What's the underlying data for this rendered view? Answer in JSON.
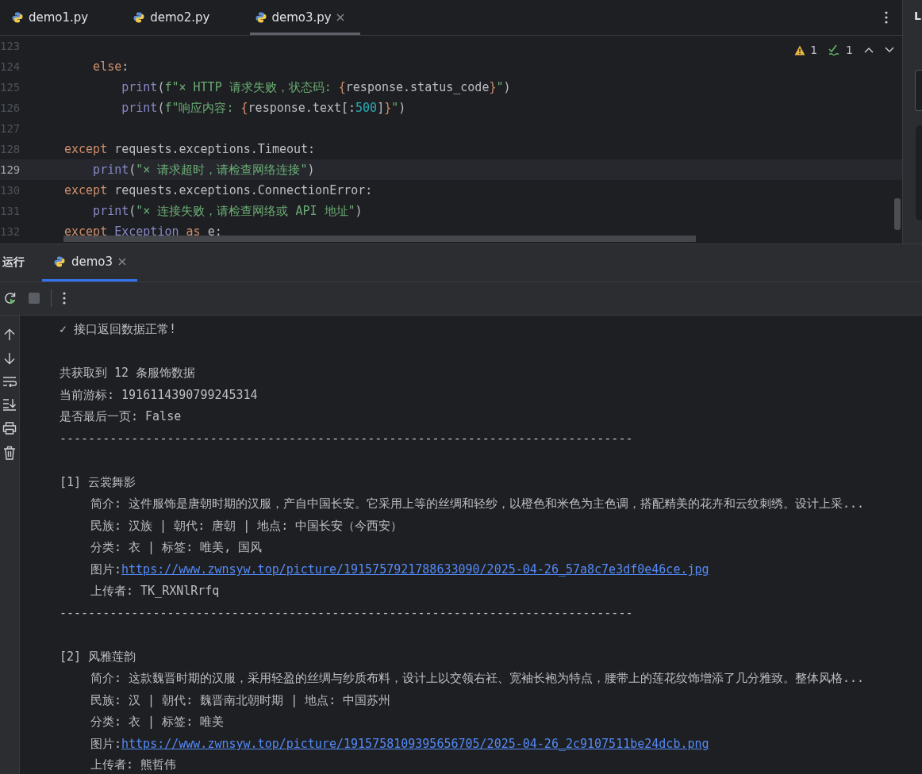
{
  "tabs": [
    {
      "label": "demo1.py",
      "selected": false
    },
    {
      "label": "demo2.py",
      "selected": false
    },
    {
      "label": "demo3.py",
      "selected": true
    }
  ],
  "side_panel": {
    "label": "L"
  },
  "editor": {
    "warnings": "1",
    "checks": "1",
    "lines": [
      {
        "number": "123",
        "current": false
      },
      {
        "number": "124",
        "current": false,
        "tokens": [
          {
            "kind": "keyword",
            "text": "    else"
          },
          {
            "kind": "plain",
            "text": ":"
          }
        ]
      },
      {
        "number": "125",
        "current": false,
        "tokens": [
          {
            "kind": "builtin",
            "text": "        print"
          },
          {
            "kind": "plain",
            "text": "("
          },
          {
            "kind": "string",
            "text": "f\"× HTTP 请求失败，状态码: "
          },
          {
            "kind": "keyword",
            "text": "{"
          },
          {
            "kind": "plain",
            "text": "response.status_code"
          },
          {
            "kind": "keyword",
            "text": "}"
          },
          {
            "kind": "string",
            "text": "\""
          },
          {
            "kind": "plain",
            "text": ")"
          }
        ]
      },
      {
        "number": "126",
        "current": false,
        "tokens": [
          {
            "kind": "builtin",
            "text": "        print"
          },
          {
            "kind": "plain",
            "text": "("
          },
          {
            "kind": "string",
            "text": "f\"响应内容: "
          },
          {
            "kind": "keyword",
            "text": "{"
          },
          {
            "kind": "plain",
            "text": "response.text[:"
          },
          {
            "kind": "number",
            "text": "500"
          },
          {
            "kind": "plain",
            "text": "]"
          },
          {
            "kind": "keyword",
            "text": "}"
          },
          {
            "kind": "string",
            "text": "\""
          },
          {
            "kind": "plain",
            "text": ")"
          }
        ]
      },
      {
        "number": "127",
        "current": false
      },
      {
        "number": "128",
        "current": false,
        "tokens": [
          {
            "kind": "keyword",
            "text": "except "
          },
          {
            "kind": "plain",
            "text": "requests.exceptions.Timeout:"
          }
        ]
      },
      {
        "number": "129",
        "current": true,
        "tokens": [
          {
            "kind": "builtin",
            "text": "    print"
          },
          {
            "kind": "plain",
            "text": "("
          },
          {
            "kind": "string",
            "text": "\"× 请求超时，请检查网络连接\""
          },
          {
            "kind": "plain",
            "text": ")"
          }
        ]
      },
      {
        "number": "130",
        "current": false,
        "tokens": [
          {
            "kind": "keyword",
            "text": "except "
          },
          {
            "kind": "plain",
            "text": "requests.exceptions.ConnectionError:"
          }
        ]
      },
      {
        "number": "131",
        "current": false,
        "tokens": [
          {
            "kind": "builtin",
            "text": "    print"
          },
          {
            "kind": "plain",
            "text": "("
          },
          {
            "kind": "string",
            "text": "\"× 连接失败，请检查网络或 API 地址\""
          },
          {
            "kind": "plain",
            "text": ")"
          }
        ]
      },
      {
        "number": "132",
        "current": false,
        "tokens": [
          {
            "kind": "keyword",
            "text": "except "
          },
          {
            "kind": "builtin",
            "text": "Exception "
          },
          {
            "kind": "keyword",
            "text": "as "
          },
          {
            "kind": "plain",
            "text": "e:"
          }
        ]
      }
    ]
  },
  "run_panel": {
    "title": "运行",
    "tabs": [
      {
        "label": "demo3",
        "selected": true
      }
    ]
  },
  "console": [
    {
      "kind": "text",
      "indent": false,
      "parts": [
        {
          "kind": "text",
          "text": "✓ 接口返回数据正常!"
        }
      ]
    },
    {
      "kind": "blank"
    },
    {
      "kind": "text",
      "indent": false,
      "parts": [
        {
          "kind": "text",
          "text": "共获取到 12 条服饰数据"
        }
      ]
    },
    {
      "kind": "text",
      "indent": false,
      "parts": [
        {
          "kind": "text",
          "text": "当前游标: 1916114390799245314"
        }
      ]
    },
    {
      "kind": "text",
      "indent": false,
      "parts": [
        {
          "kind": "text",
          "text": "是否最后一页: False"
        }
      ]
    },
    {
      "kind": "text",
      "indent": false,
      "parts": [
        {
          "kind": "text",
          "text": "--------------------------------------------------------------------------------"
        }
      ]
    },
    {
      "kind": "blank"
    },
    {
      "kind": "text",
      "indent": false,
      "parts": [
        {
          "kind": "text",
          "text": "[1] 云裳舞影"
        }
      ]
    },
    {
      "kind": "text",
      "indent": true,
      "parts": [
        {
          "kind": "text",
          "text": "简介: 这件服饰是唐朝时期的汉服，产自中国长安。它采用上等的丝绸和轻纱，以橙色和米色为主色调，搭配精美的花卉和云纹刺绣。设计上采..."
        }
      ]
    },
    {
      "kind": "text",
      "indent": true,
      "parts": [
        {
          "kind": "text",
          "text": "民族: 汉族 | 朝代: 唐朝 | 地点: 中国长安（今西安）"
        }
      ]
    },
    {
      "kind": "text",
      "indent": true,
      "parts": [
        {
          "kind": "text",
          "text": "分类: 衣 | 标签: 唯美, 国风"
        }
      ]
    },
    {
      "kind": "text",
      "indent": true,
      "parts": [
        {
          "kind": "text",
          "text": "图片: "
        },
        {
          "kind": "link",
          "text": "https://www.zwnsyw.top/picture/1915757921788633090/2025-04-26_57a8c7e3df0e46ce.jpg"
        }
      ]
    },
    {
      "kind": "text",
      "indent": true,
      "parts": [
        {
          "kind": "text",
          "text": "上传者: TK_RXNlRrfq"
        }
      ]
    },
    {
      "kind": "text",
      "indent": false,
      "parts": [
        {
          "kind": "text",
          "text": "--------------------------------------------------------------------------------"
        }
      ]
    },
    {
      "kind": "blank"
    },
    {
      "kind": "text",
      "indent": false,
      "parts": [
        {
          "kind": "text",
          "text": "[2] 风雅莲韵"
        }
      ]
    },
    {
      "kind": "text",
      "indent": true,
      "parts": [
        {
          "kind": "text",
          "text": "简介: 这款魏晋时期的汉服，采用轻盈的丝绸与纱质布料，设计上以交领右衽、宽袖长袍为特点，腰带上的莲花纹饰增添了几分雅致。整体风格..."
        }
      ]
    },
    {
      "kind": "text",
      "indent": true,
      "parts": [
        {
          "kind": "text",
          "text": "民族: 汉 | 朝代: 魏晋南北朝时期 | 地点: 中国苏州"
        }
      ]
    },
    {
      "kind": "text",
      "indent": true,
      "parts": [
        {
          "kind": "text",
          "text": "分类: 衣 | 标签: 唯美"
        }
      ]
    },
    {
      "kind": "text",
      "indent": true,
      "parts": [
        {
          "kind": "text",
          "text": "图片: "
        },
        {
          "kind": "link",
          "text": "https://www.zwnsyw.top/picture/1915758109395656705/2025-04-26_2c9107511be24dcb.png"
        }
      ]
    },
    {
      "kind": "text",
      "indent": true,
      "parts": [
        {
          "kind": "text",
          "text": "上传者: 熊哲伟"
        }
      ]
    }
  ]
}
